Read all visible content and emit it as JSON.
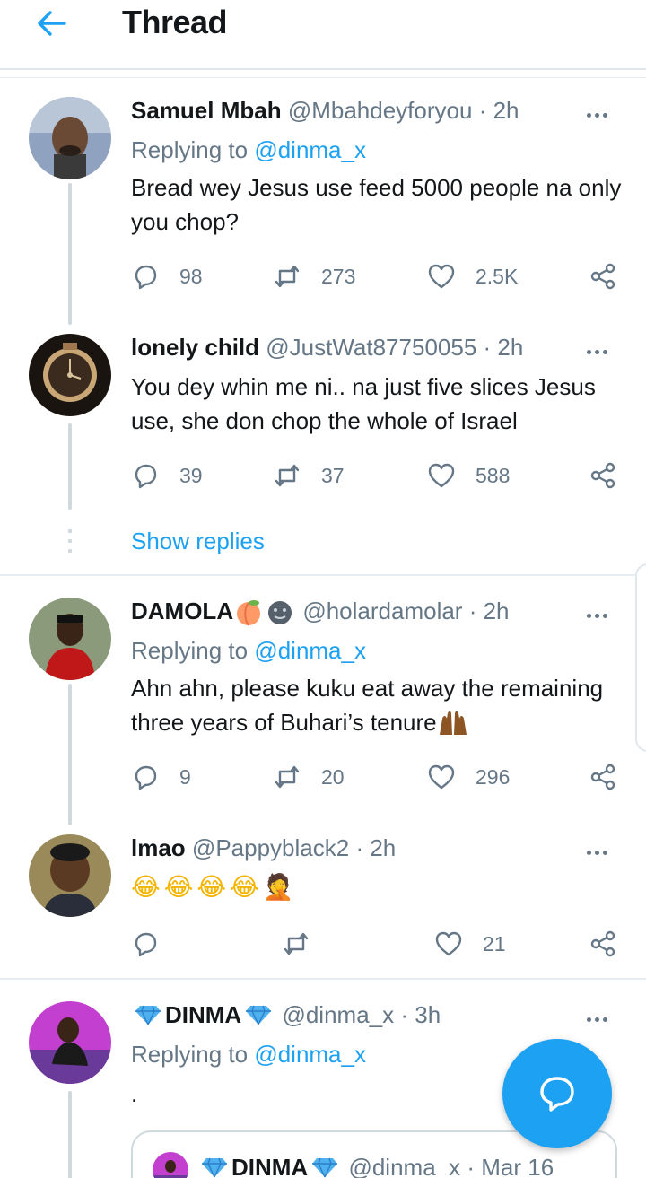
{
  "header": {
    "title": "Thread"
  },
  "tweets": [
    {
      "name": "Samuel Mbah",
      "handle": "@Mbahdeyforyou",
      "time": "· 2h",
      "replying_label": "Replying to",
      "replying_handle": "@dinma_x",
      "text": "Bread wey Jesus use feed 5000 people na only you chop?",
      "replies": "98",
      "retweets": "273",
      "likes": "2.5K"
    },
    {
      "name": "lonely child",
      "handle": "@JustWat87750055",
      "time": "· 2h",
      "text": "You dey whin me ni.. na just five slices Jesus use, she don chop the whole of Israel",
      "replies": "39",
      "retweets": "37",
      "likes": "588"
    },
    {
      "name": "DAMOLA",
      "handle": "@holardamolar",
      "time": "· 2h",
      "replying_label": "Replying to",
      "replying_handle": "@dinma_x",
      "text": "Ahn ahn, please kuku eat away the remaining three years of Buhari’s tenure",
      "replies": "9",
      "retweets": "20",
      "likes": "296"
    },
    {
      "name": "lmao",
      "handle": "@Pappyblack2",
      "time": "· 2h",
      "text": "😂😂😂😂🤦",
      "replies": "",
      "retweets": "",
      "likes": "21"
    },
    {
      "name": "DINMA",
      "handle": "@dinma_x",
      "time": "· 3h",
      "replying_label": "Replying to",
      "replying_handle": "@dinma_x",
      "text": "."
    }
  ],
  "show_replies": "Show replies",
  "quote": {
    "name": "DINMA",
    "handle": "@dinma_x",
    "time": "· Mar 16"
  },
  "colors": {
    "accent": "#1da1f2",
    "muted": "#657786",
    "line": "#cfd9de"
  }
}
